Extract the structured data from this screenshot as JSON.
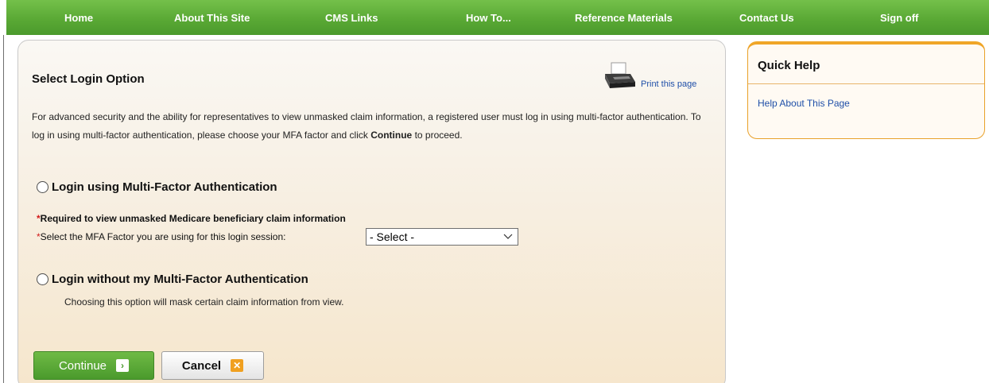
{
  "nav": {
    "items": [
      "Home",
      "About This Site",
      "CMS Links",
      "How To...",
      "Reference Materials",
      "Contact Us",
      "Sign off"
    ]
  },
  "main": {
    "title": "Select Login Option",
    "print_link": "Print this page",
    "intro_text": "For advanced security and the ability for representatives to view unmasked claim information, a registered user must log in using multi-factor authentication. To log in using multi-factor authentication, please choose your MFA factor and click ",
    "intro_bold": "Continue",
    "intro_tail": " to proceed.",
    "option_mfa": "Login using Multi-Factor Authentication",
    "required_star": "*",
    "required_text": "Required to view unmasked Medicare beneficiary claim information",
    "select_label": "Select the MFA Factor you are using for this login session:",
    "select_value": "- Select -",
    "option_no_mfa": "Login without my Multi-Factor Authentication",
    "no_mfa_note": "Choosing this option will mask certain claim information from view.",
    "continue_label": "Continue",
    "cancel_label": "Cancel"
  },
  "quick_help": {
    "title": "Quick Help",
    "link": "Help About This Page"
  },
  "colors": {
    "nav_green": "#5aa935",
    "link_blue": "#1f4fa8",
    "help_orange": "#f0a628",
    "required_red": "#d21a1a"
  }
}
